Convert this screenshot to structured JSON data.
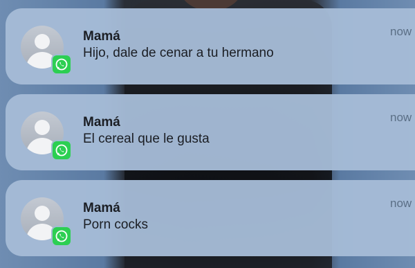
{
  "notifications": [
    {
      "sender": "Mamá",
      "message": "Hijo, dale de cenar a tu hermano",
      "time": "now",
      "avatar_icon": "person-silhouette-icon",
      "app_icon": "whatsapp-icon"
    },
    {
      "sender": "Mamá",
      "message": "El cereal que le gusta",
      "time": "now",
      "avatar_icon": "person-silhouette-icon",
      "app_icon": "whatsapp-icon"
    },
    {
      "sender": "Mamá",
      "message": "Porn cocks",
      "time": "now",
      "avatar_icon": "person-silhouette-icon",
      "app_icon": "whatsapp-icon"
    }
  ],
  "colors": {
    "card_background": "#a5bbd6",
    "app_badge": "#2ccf52",
    "text_primary": "#1b1e24",
    "time_text": "#5b6f86"
  }
}
